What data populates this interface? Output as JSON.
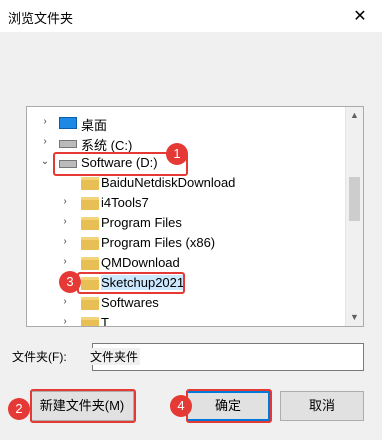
{
  "window": {
    "title": "浏览文件夹",
    "close_glyph": "✕"
  },
  "tree": [
    {
      "label": "桌面",
      "icon": "desktop-icon",
      "expander": "›"
    },
    {
      "label": "系统 (C:)",
      "icon": "drive-icon",
      "expander": "›"
    },
    {
      "label": "Software (D:)",
      "icon": "drive-icon",
      "expander": "⌄"
    },
    {
      "label": "BaiduNetdiskDownload",
      "icon": "folder-icon"
    },
    {
      "label": "i4Tools7",
      "icon": "folder-icon",
      "expander": "›"
    },
    {
      "label": "Program Files",
      "icon": "folder-icon",
      "expander": "›"
    },
    {
      "label": "Program Files (x86)",
      "icon": "folder-icon",
      "expander": "›"
    },
    {
      "label": "QMDownload",
      "icon": "folder-icon",
      "expander": "›"
    },
    {
      "label": "Sketchup2021",
      "icon": "folder-icon",
      "selected": true
    },
    {
      "label": "Softwares",
      "icon": "folder-icon",
      "expander": "›"
    },
    {
      "label": "T",
      "icon": "folder-icon",
      "expander": "›"
    }
  ],
  "folder_label": "文件夹(F):",
  "folder_value": "文件夹件",
  "buttons": {
    "new_folder": "新建文件夹(M)",
    "ok": "确定",
    "cancel": "取消"
  },
  "badges": [
    "1",
    "2",
    "3",
    "4"
  ],
  "colors": {
    "accent": "#0078d7",
    "annotation": "#e53935",
    "selection": "#cce8ff"
  }
}
